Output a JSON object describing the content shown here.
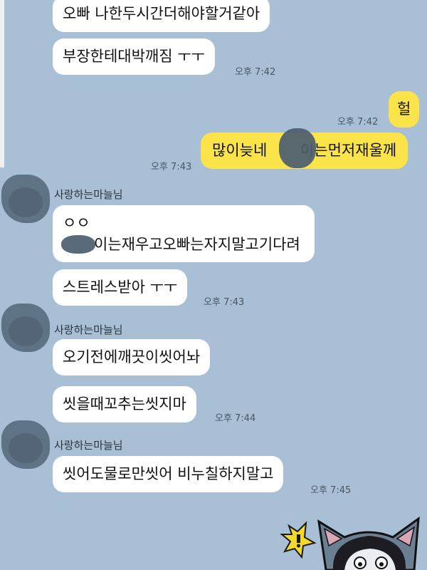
{
  "messages": [
    {
      "text": "오빠 나한두시간더해야할거같아"
    },
    {
      "text": "부장한테대박깨짐 ㅜㅜ",
      "time": "오후 7:42"
    },
    {
      "text": "헐",
      "time": "오후 7:42"
    },
    {
      "text": "많이늦네 ",
      "text_after_blur": "이는먼저재울께",
      "time": "오후 7:43"
    },
    {
      "sender": "사랑하는마늘님",
      "line1": "ㅇㅇ",
      "line2": "이는재우고오빠는자지말고기다려"
    },
    {
      "text": "스트레스받아 ㅜㅜ",
      "time": "오후 7:43"
    },
    {
      "sender": "사랑하는마늘님",
      "text": "오기전에깨끗이씻어놔"
    },
    {
      "text": "씻을때꼬추는씻지마",
      "time": "오후 7:44"
    },
    {
      "sender": "사랑하는마늘님",
      "text": "씻어도물로만씻어 비누칠하지말고",
      "time": "오후 7:45"
    }
  ],
  "sticker": {
    "description_icon": "cat-sticker-icon"
  },
  "colors": {
    "background": "#a9bfd5",
    "my_bubble": "#fbe44a",
    "their_bubble": "#ffffff"
  }
}
